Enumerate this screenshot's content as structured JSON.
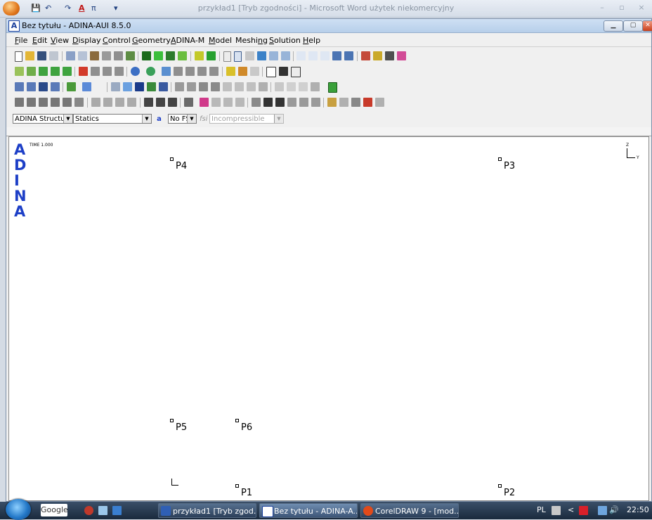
{
  "word_window": {
    "title": "przykład1 [Tryb zgodności] - Microsoft Word użytek niekomercyjny",
    "qa_buttons": [
      "💾",
      "↶",
      "↷",
      "A",
      "π",
      "▾"
    ],
    "controls": [
      "–",
      "▫",
      "×"
    ]
  },
  "adina_window": {
    "logo_letter": "A",
    "title": "Bez tytułu - ADINA-AUI  8.5.0",
    "controls": [
      "▁",
      "▢",
      "✕"
    ]
  },
  "menu": [
    {
      "pre": "",
      "key": "F",
      "post": "ile"
    },
    {
      "pre": "",
      "key": "E",
      "post": "dit"
    },
    {
      "pre": "",
      "key": "V",
      "post": "iew"
    },
    {
      "pre": "",
      "key": "D",
      "post": "isplay"
    },
    {
      "pre": "",
      "key": "C",
      "post": "ontrol"
    },
    {
      "pre": "",
      "key": "G",
      "post": "eometry"
    },
    {
      "pre": "",
      "key": "A",
      "post": "DINA-M"
    },
    {
      "pre": "",
      "key": "M",
      "post": "odel"
    },
    {
      "pre": "Meshi",
      "key": "n",
      "post": "g"
    },
    {
      "pre": "",
      "key": "S",
      "post": "olution"
    },
    {
      "pre": "",
      "key": "H",
      "post": "elp"
    }
  ],
  "combos": {
    "program": "ADINA Structur",
    "analysis": "Statics",
    "fsi": "No FSI",
    "fsi_label": "fsi",
    "flow": "Incompressible"
  },
  "canvas": {
    "logo_letters": [
      "A",
      "D",
      "I",
      "N",
      "A"
    ],
    "time_label": "TIME 1.000",
    "axis_z": "Z",
    "axis_y": "Y",
    "points": [
      "P4",
      "P3",
      "P5",
      "P6",
      "P1",
      "P2"
    ]
  },
  "taskbar": {
    "search_label": "Google",
    "buttons": [
      "przykład1 [Tryb zgod...",
      "Bez tytułu - ADINA-A...",
      "CorelDRAW 9 - [mod..."
    ],
    "language": "PL",
    "clock": "22:50"
  },
  "colors": {
    "adina_blue": "#1d3fc7",
    "taskbar_bg": "#1a2a3d"
  }
}
